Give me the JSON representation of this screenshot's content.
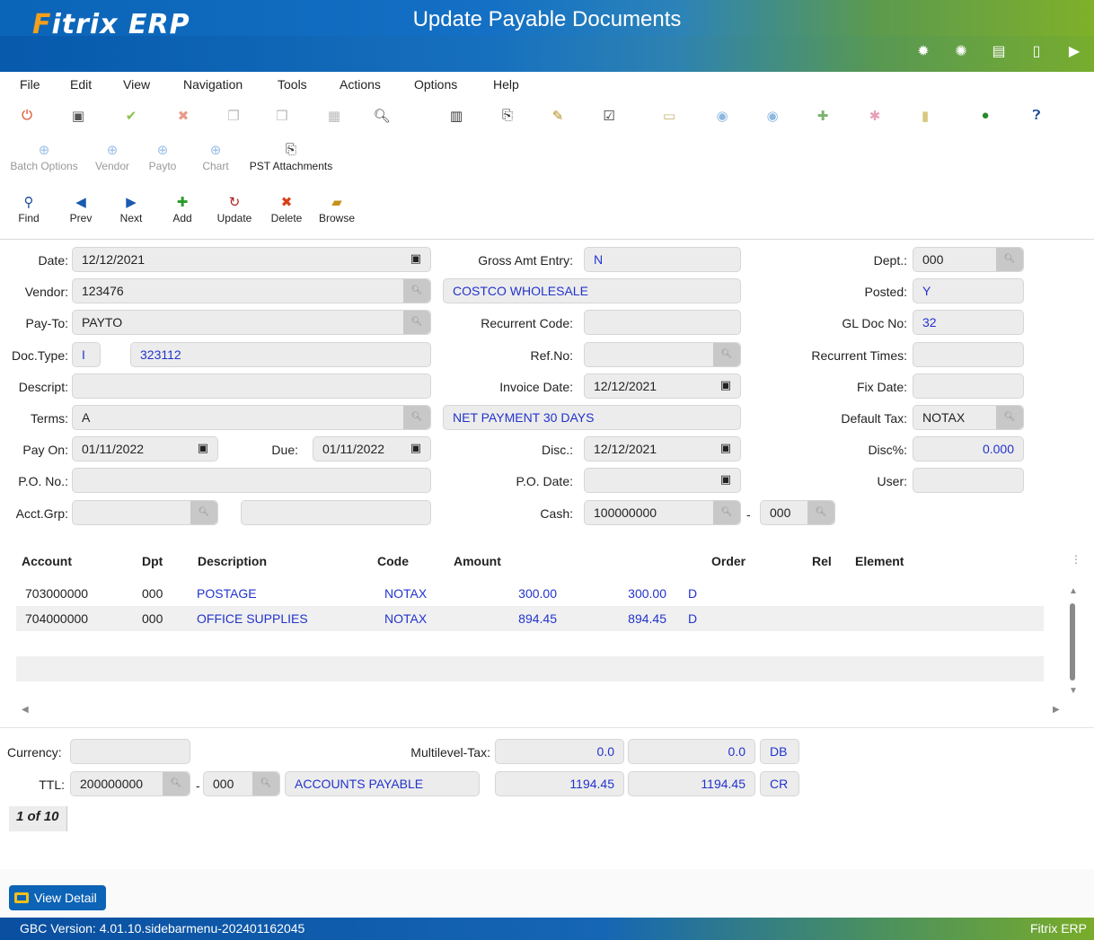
{
  "app": {
    "logo_main": "Fitrix",
    "logo_suffix": "ERP",
    "title": "Update Payable Documents",
    "header_icons": [
      "settings-icon",
      "gear-icon",
      "document-icon",
      "new-document-icon",
      "play-icon"
    ]
  },
  "menu": [
    "File",
    "Edit",
    "View",
    "Navigation",
    "Tools",
    "Actions",
    "Options",
    "Help"
  ],
  "toolbar2": [
    {
      "label": "Batch Options",
      "icon": "plus-circle-icon",
      "enabled": false
    },
    {
      "label": "Vendor",
      "icon": "plus-circle-icon",
      "enabled": false
    },
    {
      "label": "Payto",
      "icon": "plus-circle-icon",
      "enabled": false
    },
    {
      "label": "Chart",
      "icon": "plus-circle-icon",
      "enabled": false
    },
    {
      "label": "PST Attachments",
      "icon": "attachment-icon",
      "enabled": true
    }
  ],
  "toolbar3": [
    {
      "label": "Find",
      "icon": "search-icon"
    },
    {
      "label": "Prev",
      "icon": "prev-icon"
    },
    {
      "label": "Next",
      "icon": "next-icon"
    },
    {
      "label": "Add",
      "icon": "add-icon"
    },
    {
      "label": "Update",
      "icon": "update-icon"
    },
    {
      "label": "Delete",
      "icon": "delete-icon"
    },
    {
      "label": "Browse",
      "icon": "folder-icon"
    }
  ],
  "form": {
    "date": {
      "label": "Date:",
      "value": "12/12/2021"
    },
    "vendor": {
      "label": "Vendor:",
      "value": "123476",
      "name": "COSTCO WHOLESALE"
    },
    "payto": {
      "label": "Pay-To:",
      "value": "PAYTO"
    },
    "doctype": {
      "label": "Doc.Type:",
      "value": "I",
      "docno": "323112"
    },
    "descript": {
      "label": "Descript:",
      "value": ""
    },
    "terms": {
      "label": "Terms:",
      "value": "A",
      "desc": "NET PAYMENT 30 DAYS"
    },
    "payon": {
      "label": "Pay On:",
      "value": "01/11/2022"
    },
    "due": {
      "label": "Due:",
      "value": "01/11/2022"
    },
    "pono": {
      "label": "P.O. No.:",
      "value": ""
    },
    "acctgrp": {
      "label": "Acct.Grp:",
      "value": ""
    },
    "gross_amt": {
      "label": "Gross Amt Entry:",
      "value": "N"
    },
    "recurrent_code": {
      "label": "Recurrent Code:",
      "value": ""
    },
    "refno": {
      "label": "Ref.No:",
      "value": ""
    },
    "invoice_date": {
      "label": "Invoice Date:",
      "value": "12/12/2021"
    },
    "disc": {
      "label": "Disc.:",
      "value": "12/12/2021"
    },
    "po_date": {
      "label": "P.O. Date:",
      "value": ""
    },
    "cash": {
      "label": "Cash:",
      "value": "100000000",
      "sub": "000",
      "dash": "-"
    },
    "dept": {
      "label": "Dept.:",
      "value": "000"
    },
    "posted": {
      "label": "Posted:",
      "value": "Y"
    },
    "gl_doc": {
      "label": "GL Doc No:",
      "value": "32"
    },
    "recurrent_times": {
      "label": "Recurrent Times:",
      "value": ""
    },
    "fix_date": {
      "label": "Fix Date:",
      "value": ""
    },
    "default_tax": {
      "label": "Default Tax:",
      "value": "NOTAX"
    },
    "disc_pct": {
      "label": "Disc%:",
      "value": "0.000"
    },
    "user": {
      "label": "User:",
      "value": ""
    }
  },
  "grid": {
    "headers": [
      "Account",
      "Dpt",
      "Description",
      "Code",
      "Amount",
      "Order",
      "Rel",
      "Element"
    ],
    "rows": [
      {
        "account": "703000000",
        "dpt": "000",
        "description": "POSTAGE",
        "code": "NOTAX",
        "amount": "300.00",
        "amount2": "300.00",
        "dc": "D"
      },
      {
        "account": "704000000",
        "dpt": "000",
        "description": "OFFICE SUPPLIES",
        "code": "NOTAX",
        "amount": "894.45",
        "amount2": "894.45",
        "dc": "D"
      }
    ]
  },
  "totals": {
    "currency_label": "Currency:",
    "currency_value": "",
    "multilevel_label": "Multilevel-Tax:",
    "multilevel_1": "0.0",
    "multilevel_2": "0.0",
    "multilevel_flag": "DB",
    "ttl_label": "TTL:",
    "ttl_account": "200000000",
    "ttl_sub": "000",
    "ttl_dash": "-",
    "ttl_desc": "ACCOUNTS PAYABLE",
    "ttl_1": "1194.45",
    "ttl_2": "1194.45",
    "ttl_flag": "CR"
  },
  "pager": "1 of 10",
  "view_detail": "View Detail",
  "status": {
    "version": "GBC Version: 4.01.10.sidebarmenu-202401162045",
    "brand": "Fitrix ERP"
  }
}
